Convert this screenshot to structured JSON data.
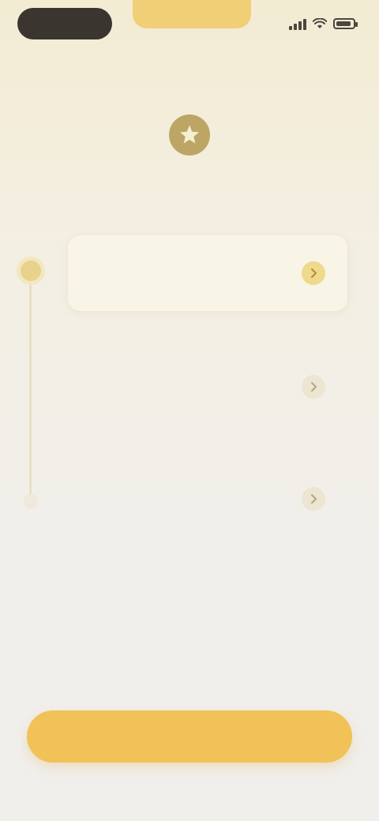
{
  "status_bar": {
    "time": "",
    "notch_label": "",
    "icons": [
      "signal-icon",
      "wifi-icon",
      "battery-icon"
    ]
  },
  "header": {
    "icon": "star-icon",
    "title": ""
  },
  "steps": [
    {
      "label": "",
      "description": "",
      "state": "active",
      "icon": "chevron-right-icon"
    },
    {
      "label": "",
      "description": "",
      "state": "inactive",
      "icon": "chevron-right-icon"
    },
    {
      "label": "",
      "description": "",
      "state": "inactive",
      "icon": "chevron-right-icon"
    }
  ],
  "cta": {
    "label": ""
  },
  "colors": {
    "accent": "#f1c257",
    "accent_light": "#efd98c",
    "background": "#f1efeb",
    "dark_pill": "#3a352f"
  }
}
